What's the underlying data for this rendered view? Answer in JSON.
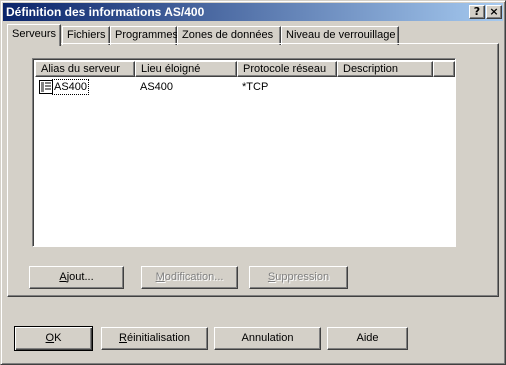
{
  "window": {
    "title": "Définition des informations AS/400",
    "help_btn": "?",
    "close_btn": "×"
  },
  "tabs": [
    {
      "label": "Serveurs",
      "active": true
    },
    {
      "label": "Fichiers",
      "active": false
    },
    {
      "label": "Programmes",
      "active": false
    },
    {
      "label": "Zones de données",
      "active": false
    },
    {
      "label": "Niveau de verrouillage",
      "active": false
    }
  ],
  "list": {
    "columns": [
      "Alias du serveur",
      "Lieu éloigné",
      "Protocole réseau",
      "Description"
    ],
    "rows": [
      {
        "alias": "AS400",
        "lieu": "AS400",
        "protocole": "*TCP",
        "description": "",
        "icon": "server-icon"
      }
    ]
  },
  "panel_buttons": {
    "ajout": {
      "pre": "",
      "u": "A",
      "post": "jout..."
    },
    "modification": {
      "pre": "",
      "u": "M",
      "post": "odification..."
    },
    "suppression": {
      "pre": "",
      "u": "S",
      "post": "uppression"
    }
  },
  "dialog_buttons": {
    "ok": {
      "pre": "",
      "u": "O",
      "post": "K"
    },
    "reinit": {
      "pre": "",
      "u": "R",
      "post": "éinitialisation"
    },
    "annulation": "Annulation",
    "aide": "Aide"
  },
  "colors": {
    "title_start": "#0a246a",
    "title_end": "#a6caf0",
    "face": "#d4d0c8"
  }
}
